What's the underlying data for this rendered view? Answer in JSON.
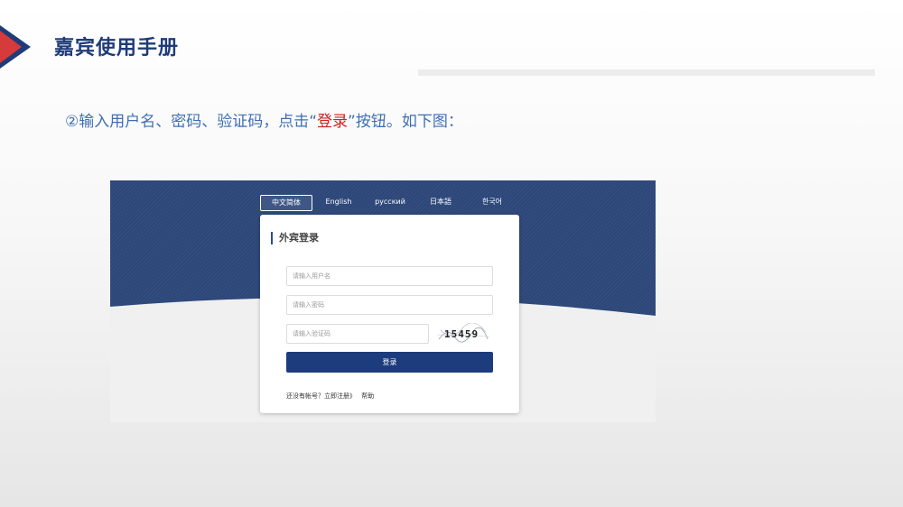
{
  "slide": {
    "title": "嘉宾使用手册",
    "instruction": {
      "before": "②输入用户名、密码、验证码，点击“",
      "highlight": "登录",
      "after": "”按钮。如下图："
    }
  },
  "colors": {
    "title": "#1f3b78",
    "instruction": "#3e6fb3",
    "highlight": "#d02020",
    "banner": "#2d4779",
    "button": "#1d3c7e"
  },
  "login_page": {
    "languages": [
      "中文简体",
      "English",
      "русский",
      "日本語",
      "한국어"
    ],
    "active_language": "中文简体",
    "card_title": "外宾登录",
    "username_placeholder": "请输入用户名",
    "password_placeholder": "请输入密码",
    "captcha_placeholder": "请输入验证码",
    "captcha_text": "15459",
    "login_button": "登录",
    "register_text": "还没有帐号？立即注册》",
    "help_text": "帮助"
  }
}
